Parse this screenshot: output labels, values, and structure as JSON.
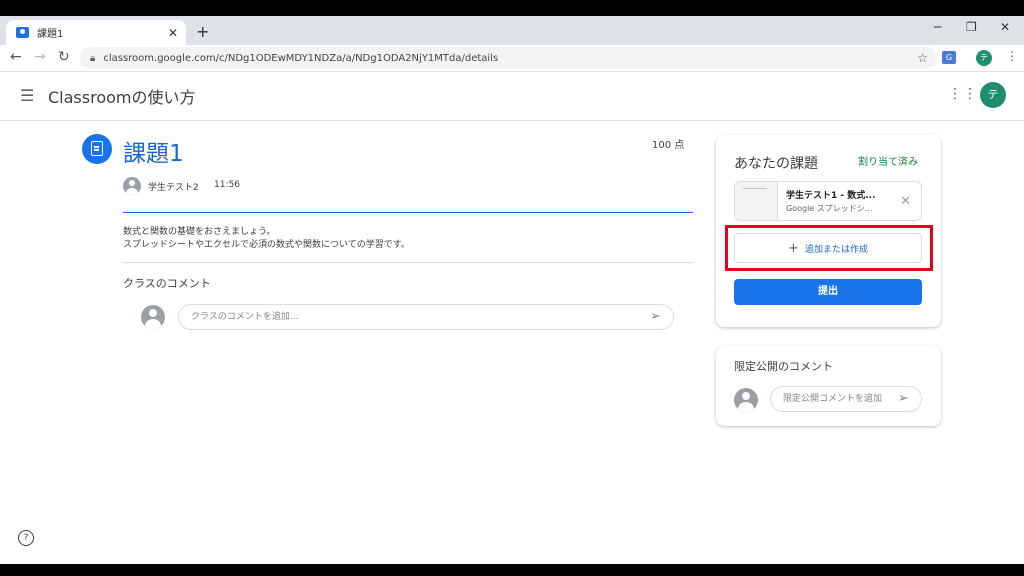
{
  "browser": {
    "tab_title": "課題1",
    "new_tab": "+",
    "url": "classroom.google.com/c/NDg1ODEwMDY1NDZa/a/NDg1ODA2NjY1MTda/details",
    "profile_initial": "テ",
    "extension_label": "G"
  },
  "header": {
    "app_name": "Classroomの使い方",
    "avatar_initial": "テ"
  },
  "assignment": {
    "title": "課題1",
    "points": "100 点",
    "author": "学生テスト2",
    "time": "11:56",
    "description_line1": "数式と関数の基礎をおさえましょう。",
    "description_line2": "スプレッドシートやエクセルで必須の数式や関数についての学習です。"
  },
  "class_comments": {
    "label": "クラスのコメント",
    "placeholder": "クラスのコメントを追加..."
  },
  "your_work": {
    "title": "あなたの課題",
    "status": "割り当て済み",
    "attachment_name": "学生テスト1 - 数式...",
    "attachment_type": "Google スプレッドシ...",
    "add_label": "追加または作成",
    "submit_label": "提出"
  },
  "private_comments": {
    "label": "限定公開のコメント",
    "placeholder": "限定公開コメントを追加"
  },
  "colors": {
    "accent": "#1a73e8",
    "status": "#188038",
    "highlight": "#e8001c"
  }
}
